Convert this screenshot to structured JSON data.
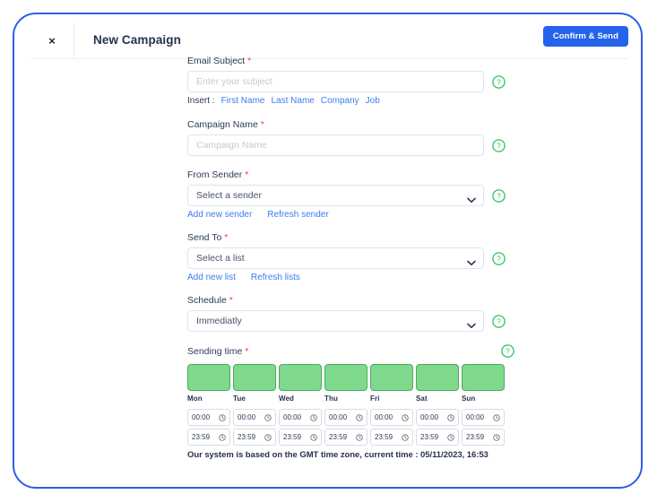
{
  "header": {
    "close_label": "×",
    "title": "New Campaign",
    "confirm_label": "Confirm & Send"
  },
  "form": {
    "email_subject": {
      "label": "Email Subject",
      "required": "*",
      "placeholder": "Enter your subject",
      "value": "",
      "help": "?",
      "insert_label": "Insert :",
      "insert_links": [
        "First Name",
        "Last Name",
        "Company",
        "Job"
      ]
    },
    "campaign_name": {
      "label": "Campaign Name",
      "required": "*",
      "placeholder": "Campaign Name",
      "value": "",
      "help": "?"
    },
    "from_sender": {
      "label": "From Sender",
      "required": "*",
      "selected": "Select a sender",
      "help": "?",
      "links": [
        "Add new sender",
        "Refresh sender"
      ]
    },
    "send_to": {
      "label": "Send To",
      "required": "*",
      "selected": "Select a list",
      "help": "?",
      "links": [
        "Add new list",
        "Refresh lists"
      ]
    },
    "schedule": {
      "label": "Schedule",
      "required": "*",
      "selected": "Immediatly",
      "help": "?"
    },
    "sending_time": {
      "label": "Sending time",
      "required": "*",
      "help": "?",
      "days": [
        {
          "name": "Mon",
          "enabled": true,
          "start": "00:00",
          "end": "23:59"
        },
        {
          "name": "Tue",
          "enabled": true,
          "start": "00:00",
          "end": "23:59"
        },
        {
          "name": "Wed",
          "enabled": true,
          "start": "00:00",
          "end": "23:59"
        },
        {
          "name": "Thu",
          "enabled": true,
          "start": "00:00",
          "end": "23:59"
        },
        {
          "name": "Fri",
          "enabled": true,
          "start": "00:00",
          "end": "23:59"
        },
        {
          "name": "Sat",
          "enabled": true,
          "start": "00:00",
          "end": "23:59"
        },
        {
          "name": "Sun",
          "enabled": true,
          "start": "00:00",
          "end": "23:59"
        }
      ],
      "gmt_note": "Our system is based on the GMT time zone, current time : 05/11/2023, 16:53"
    }
  },
  "colors": {
    "accent_blue": "#2563ec",
    "frame_blue": "#2f5ce8",
    "link_blue": "#3c7df0",
    "day_green": "#7fd98c",
    "day_green_border": "#4aab5c",
    "help_green": "#2fc25b",
    "required_red": "#f0452f",
    "text_navy": "#26324d"
  }
}
